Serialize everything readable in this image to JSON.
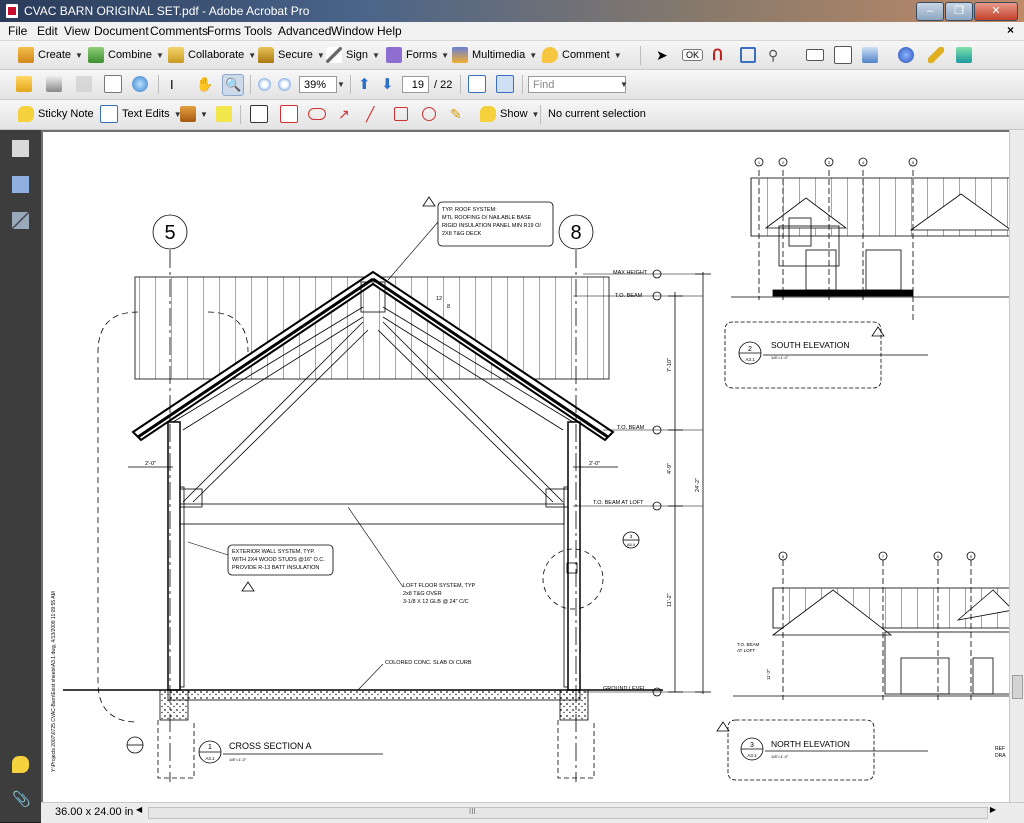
{
  "window": {
    "title": "CVAC BARN ORIGINAL SET.pdf - Adobe Acrobat Pro",
    "minimize": "‒",
    "maximize": "❐",
    "close": "✕"
  },
  "menu": [
    "File",
    "Edit",
    "View",
    "Document",
    "Comments",
    "Forms",
    "Tools",
    "Advanced",
    "Window",
    "Help"
  ],
  "menu_close": "×",
  "toolbar1": {
    "create": "Create",
    "combine": "Combine",
    "collaborate": "Collaborate",
    "secure": "Secure",
    "sign": "Sign",
    "forms": "Forms",
    "multimedia": "Multimedia",
    "comment": "Comment",
    "ok": "OK"
  },
  "toolbar2": {
    "zoom": "39%",
    "page_current": "19",
    "page_total": "/ 22",
    "find_placeholder": "Find"
  },
  "toolbar3": {
    "sticky": "Sticky Note",
    "text_edits": "Text Edits",
    "show": "Show",
    "selection": "No current selection"
  },
  "status": {
    "page_size": "36.00 x 24.00 in"
  },
  "drawing": {
    "grid_a": "5",
    "grid_b": "8",
    "roof_note": [
      "TYP. ROOF SYSTEM:",
      "MTL ROOFING O/ NAILABLE BASE",
      "RIGID INSULATION PANEL MIN R19 O/",
      "2X8 T&G DECK"
    ],
    "pitch": "12",
    "pitch_run": "8",
    "levels": [
      "MAX HEIGHT",
      "T.O. BEAM",
      "T.O. BEAM",
      "T.O. BEAM AT LOFT",
      "GROUND LEVEL"
    ],
    "dims": [
      "7'-10\"",
      "4'-9\"",
      "11'-2\"",
      "24'-2\"",
      "2'-0\"",
      "2'-0\""
    ],
    "wall_note": [
      "EXTERIOR WALL SYSTEM, TYP.",
      "WITH 2X4 WOOD STUDS @16\" O.C.",
      "PROVIDE R-13 BATT INSULATION"
    ],
    "loft_note": [
      "LOFT FLOOR SYSTEM, TYP",
      "2x8 T&G OVER",
      "3-1/8 X 12 GLB @ 24\" C/C"
    ],
    "slab_note": "COLORED CONC. SLAB O/ CURB",
    "section_title": "CROSS SECTION A",
    "section_num": "1",
    "section_sheet": "A3.1",
    "section_scale": "1/8\"=1'-0\"",
    "south_title": "SOUTH ELEVATION",
    "south_num": "2",
    "south_sheet": "A3.1",
    "south_scale": "1/8\"=1'-0\"",
    "north_title": "NORTH ELEVATION",
    "north_num": "3",
    "north_sheet": "A3.1",
    "north_scale": "1/8\"=1'-0\"",
    "north_label1": "T.O. BEAM",
    "north_label2": "AT LOFT",
    "north_dim": "11'-2\"",
    "south_grids": [
      "1",
      "2",
      "3",
      "4",
      "5"
    ],
    "north_grids": [
      "8",
      "7",
      "6",
      "5"
    ],
    "detail_ref": "3",
    "detail_sheet": "A5.0",
    "side_path": "Y:\\Projects 2007\\0725 CVAC-Barn\\Exist sheets\\A3.1.dwg, 4/13/2009 11:09:55 AM",
    "corner_text": [
      "REF",
      "DRA"
    ]
  }
}
